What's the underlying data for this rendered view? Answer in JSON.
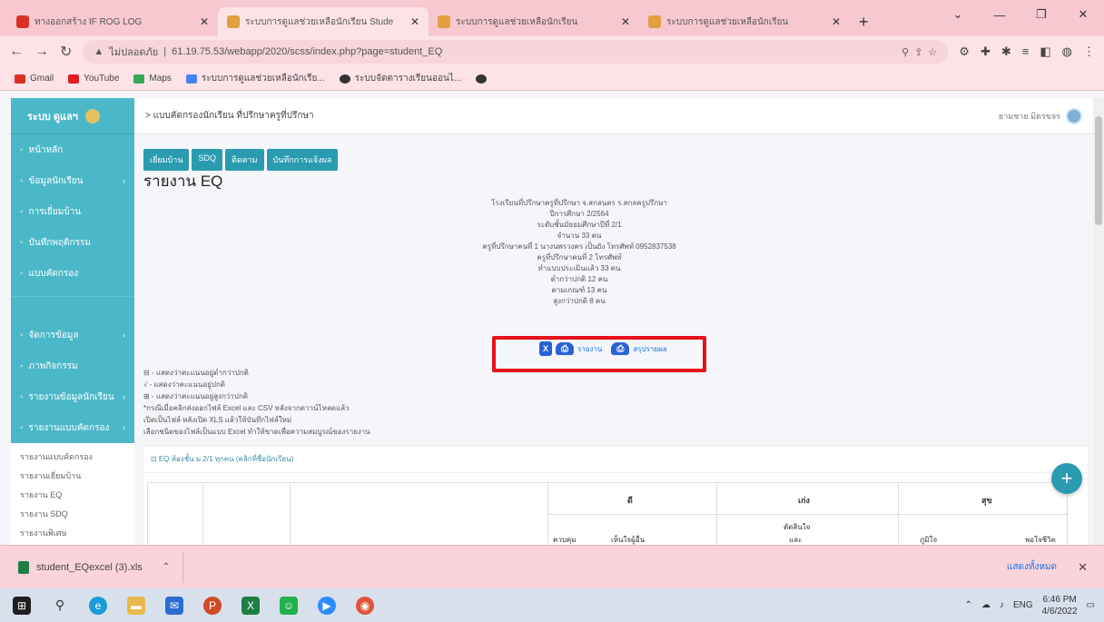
{
  "browser": {
    "tabs": [
      {
        "title": "ทางออกสร้าง IF ROG LOG",
        "color": "#d93025",
        "active": false
      },
      {
        "title": "ระบบการดูแลช่วยเหลือนักเรียน Stude",
        "color": "#e0a040",
        "active": true
      },
      {
        "title": "ระบบการดูแลช่วยเหลือนักเรียน",
        "color": "#e0a040",
        "active": false
      },
      {
        "title": "ระบบการดูแลช่วยเหลือนักเรียน",
        "color": "#e0a040",
        "active": false
      }
    ],
    "new_tab": "+",
    "address": {
      "security": "ไม่ปลอดภัย",
      "url": "61.19.75.53/webapp/2020/scss/index.php?page=student_EQ"
    },
    "bookmarks": [
      {
        "label": "Gmail",
        "color": "#d93025"
      },
      {
        "label": "YouTube",
        "color": "#e02020"
      },
      {
        "label": "Maps",
        "color": "#34a853"
      },
      {
        "label": "ระบบการดูแลช่วยเหลือนักเรีย...",
        "color": "#4285f4"
      },
      {
        "label": "ระบบจัดตารางเรียนออนไ...",
        "color": "#333333"
      }
    ]
  },
  "sidebar": {
    "brand": "ระบบ ดูแลฯ",
    "items": [
      {
        "label": "หน้าหลัก",
        "arrow": ""
      },
      {
        "label": "ข้อมูลนักเรียน",
        "arrow": "‹"
      },
      {
        "label": "การเยี่ยมบ้าน",
        "arrow": ""
      },
      {
        "label": "บันทึกพฤติกรรม",
        "arrow": ""
      },
      {
        "label": "แบบคัดกรอง",
        "arrow": ""
      },
      {
        "label": "จัดการข้อมูล",
        "arrow": "‹"
      },
      {
        "label": "ภาพกิจกรรม",
        "arrow": ""
      },
      {
        "label": "รายงานข้อมูลนักเรียน",
        "arrow": "‹"
      },
      {
        "label": "รายงานแบบคัดกรอง",
        "arrow": "‹"
      }
    ],
    "submenu": [
      "รายงานแบบคัดกรอง",
      "รายงานเยี่ยมบ้าน",
      "รายงาน EQ",
      "รายงาน SDQ",
      "รายงานพิเศษ"
    ]
  },
  "header": {
    "breadcrumb": "> แบบคัดกรองนักเรียน ที่ปรึกษาครูที่ปรึกษา",
    "user": "ยามชาย มิตรขจร"
  },
  "toolbar": {
    "buttons": [
      "เยี่ยมบ้าน",
      "SDQ",
      "ติดตาม",
      "บันทึกการแจ้งผล"
    ]
  },
  "report": {
    "title": "รายงาน EQ",
    "info_lines": [
      "โรงเรียนที่ปรึกษาครูที่ปรึกษา จ.สกลนคร ร.สกลครูปรึกษา",
      "ปีการศึกษา 2/2564",
      "ระดับชั้นมัธยมศึกษาปีที่ 2/1",
      "จำนวน 33 คน",
      "ครูที่ปรึกษาคนที่ 1 นางนพรวงคร เป็นยัง โทรศัพท์ 0952837538",
      "ครูที่ปรึกษาคนที่ 2 โทรศัพท์",
      "ทำแบบประเมินแล้ว 33 คน",
      "ต่ำกว่าปกติ 12 คน",
      "ตามเกณฑ์ 13 คน",
      "สูงกว่าปกติ 8 คน"
    ],
    "actions": {
      "excel_icon": "X",
      "print_report": "รายงาน",
      "print_summary": "สรุปรายผล"
    },
    "notes": [
      "⊟ - แสดงว่าคะแนนอยู่ต่ำกว่าปกติ",
      "√ - แสดงว่าคะแนนอยู่ปกติ",
      "⊞ - แสดงว่าคะแนนอยู่สูงกว่าปกติ",
      "*กรณีเมื่อคลิกส่งออกไฟล์ Excel และ CSV หลังจากดาวน์โหลดแล้ว",
      "เปิดเป็นไฟล์ หลังเปิด XLS แล้วให้บันทึกไฟล์ใหม่",
      "เลือกชนิดของไฟล์เป็นแบบ Excel ทำให้ขาดเพื่อความสมบูรณ์ของรายงาน"
    ],
    "card_title": "⊡ EQ ห้องชั้น ม.2/1 ทุกคน (คลิกที่ชื่อนักเรียน)",
    "table_headers": {
      "col_good": "ดี",
      "col_smart": "เก่ง",
      "col_happy": "สุข",
      "sub1": "ควบคุม",
      "sub2": "เห็นใจผู้อื่น",
      "sub3": "ตัดสินใจ",
      "sub3b": "และ",
      "sub4": "ภูมิใจ",
      "sub5": "พอใจชีวิต"
    },
    "fab": "+"
  },
  "download": {
    "file": "student_EQexcel (3).xls",
    "show_all": "แสดงทั้งหมด",
    "close": "✕"
  },
  "taskbar": {
    "icons": [
      {
        "name": "windows",
        "color": "#1f1f1f",
        "glyph": "⊞"
      },
      {
        "name": "search",
        "color": "#d8e0ec",
        "glyph": "⚲"
      },
      {
        "name": "edge",
        "color": "#1a9bd7",
        "glyph": "e"
      },
      {
        "name": "files",
        "color": "#e8b84a",
        "glyph": "▬"
      },
      {
        "name": "mail",
        "color": "#2a6ccf",
        "glyph": "✉"
      },
      {
        "name": "powerpoint",
        "color": "#d04a25",
        "glyph": "P"
      },
      {
        "name": "excel",
        "color": "#1e7e44",
        "glyph": "X"
      },
      {
        "name": "line",
        "color": "#22b14c",
        "glyph": "☺"
      },
      {
        "name": "zoom",
        "color": "#2d8cff",
        "glyph": "▶"
      },
      {
        "name": "chrome",
        "color": "#e0543c",
        "glyph": "◉"
      }
    ],
    "lang": "ENG",
    "time": "6:46 PM",
    "date": "4/6/2022"
  }
}
